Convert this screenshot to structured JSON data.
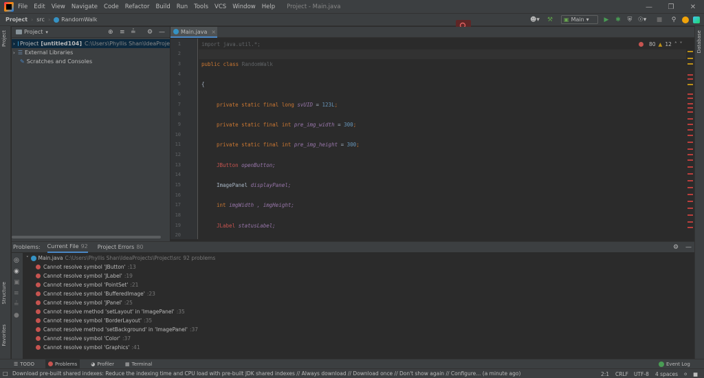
{
  "menu": {
    "items": [
      "File",
      "Edit",
      "View",
      "Navigate",
      "Code",
      "Refactor",
      "Build",
      "Run",
      "Tools",
      "VCS",
      "Window",
      "Help"
    ],
    "window_title": "Project - Main.java"
  },
  "nav": {
    "project": "Project",
    "src": "src",
    "class_name": "RandomWalk",
    "run_config": "Main"
  },
  "project_panel": {
    "title": "Project",
    "items": [
      {
        "label": "Project",
        "bold": "[untitled104]",
        "path": "C:\\Users\\Phyllis Shan\\IdeaProje"
      },
      {
        "label": "External Libraries"
      },
      {
        "label": "Scratches and Consoles"
      }
    ]
  },
  "editor": {
    "tab_label": "Main.java",
    "errors": "80",
    "warnings": "12",
    "line_numbers": [
      "1",
      "2",
      "3",
      "4",
      "5",
      "6",
      "7",
      "8",
      "9",
      "10",
      "11",
      "12",
      "13",
      "14",
      "15",
      "16",
      "17",
      "18",
      "19",
      "20"
    ],
    "lines": {
      "l1": "import java.util.*;",
      "l3_kw": "public class",
      "l3_name": "RandomWalk",
      "l5": "{",
      "l7_kw": "private static final long",
      "l7_field": "svUID",
      "l7_eq": " = ",
      "l7_val": "123L",
      "l9_kw": "private static final int",
      "l9_field": "pre_img_width",
      "l9_val": "300",
      "l11_kw": "private static final int",
      "l11_field": "pre_img_height",
      "l11_val": "300",
      "l13_type": "JButton",
      "l13_name": "openButton;",
      "l15_type": "ImagePanel",
      "l15_name": "displayPanel;",
      "l17_kw": "int",
      "l17_rest": "imgWidth , imgHeight;",
      "l19_type": "JLabel",
      "l19_name": "statusLabel;"
    }
  },
  "problems": {
    "label": "Problems:",
    "tabs": [
      {
        "label": "Current File",
        "count": "92"
      },
      {
        "label": "Project Errors",
        "count": "80"
      }
    ],
    "file": "Main.java",
    "file_path": "C:\\Users\\Phyllis Shan\\IdeaProjects\\Project\\src",
    "file_count": "92 problems",
    "rows": [
      {
        "msg": "Cannot resolve symbol 'JButton'",
        "loc": ":13"
      },
      {
        "msg": "Cannot resolve symbol 'JLabel'",
        "loc": ":19"
      },
      {
        "msg": "Cannot resolve symbol 'PointSet'",
        "loc": ":21"
      },
      {
        "msg": "Cannot resolve symbol 'BufferedImage'",
        "loc": ":23"
      },
      {
        "msg": "Cannot resolve symbol 'JPanel'",
        "loc": ":25"
      },
      {
        "msg": "Cannot resolve method 'setLayout' in 'ImagePanel'",
        "loc": ":35"
      },
      {
        "msg": "Cannot resolve symbol 'BorderLayout'",
        "loc": ":35"
      },
      {
        "msg": "Cannot resolve method 'setBackground' in 'ImagePanel'",
        "loc": ":37"
      },
      {
        "msg": "Cannot resolve symbol 'Color'",
        "loc": ":37"
      },
      {
        "msg": "Cannot resolve symbol 'Graphics'",
        "loc": ":41"
      }
    ]
  },
  "bottom_tools": {
    "todo": "TODO",
    "problems": "Problems",
    "profiler": "Profiler",
    "terminal": "Terminal",
    "event_log": "Event Log"
  },
  "side_labels": {
    "project": "Project",
    "structure": "Structure",
    "favorites": "Favorites",
    "database": "Database"
  },
  "status": {
    "message": "Download pre-built shared indexes: Reduce the indexing time and CPU load with pre-built JDK shared indexes // Always download // Download once // Don't show again // Configure... (a minute ago)",
    "position": "2:1",
    "line_sep": "CRLF",
    "encoding": "UTF-8",
    "indent": "4 spaces"
  },
  "colors": {
    "bg": "#2b2b2b",
    "panel": "#3c3f41",
    "keyword": "#cc7832",
    "field": "#9876aa",
    "number": "#6897bb",
    "error": "#c75450",
    "accent": "#4a88c7"
  }
}
